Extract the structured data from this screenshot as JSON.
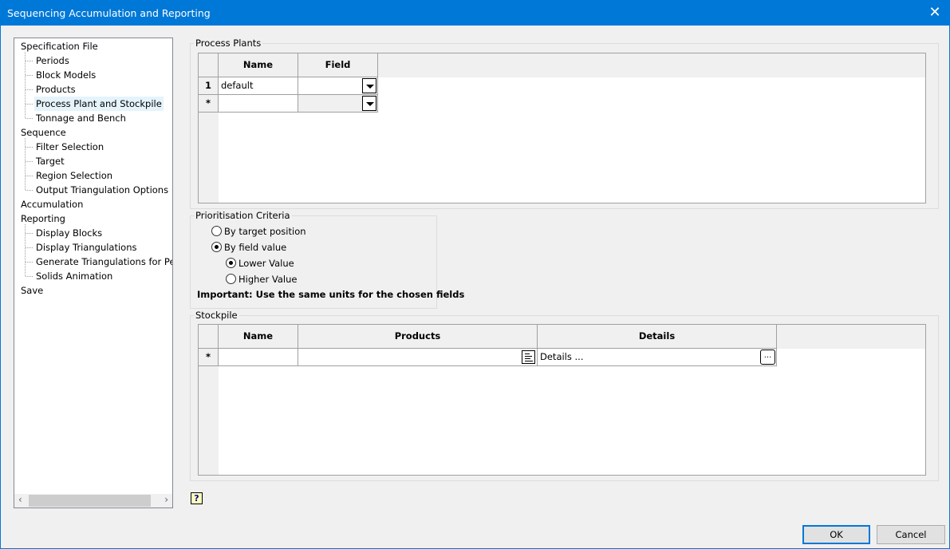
{
  "window": {
    "title": "Sequencing Accumulation and Reporting",
    "close": "✕"
  },
  "tree": {
    "items": [
      {
        "label": "Specification File",
        "level": 0
      },
      {
        "label": "Periods",
        "level": 1
      },
      {
        "label": "Block Models",
        "level": 1
      },
      {
        "label": "Products",
        "level": 1
      },
      {
        "label": "Process Plant and Stockpile",
        "level": 1,
        "selected": true
      },
      {
        "label": "Tonnage and Bench",
        "level": 1
      },
      {
        "label": "Sequence",
        "level": 0
      },
      {
        "label": "Filter Selection",
        "level": 1
      },
      {
        "label": "Target",
        "level": 1
      },
      {
        "label": "Region Selection",
        "level": 1
      },
      {
        "label": "Output Triangulation Options",
        "level": 1
      },
      {
        "label": "Accumulation",
        "level": 0
      },
      {
        "label": "Reporting",
        "level": 0
      },
      {
        "label": "Display Blocks",
        "level": 1
      },
      {
        "label": "Display Triangulations",
        "level": 1
      },
      {
        "label": "Generate Triangulations for Periods",
        "level": 1
      },
      {
        "label": "Solids Animation",
        "level": 1
      },
      {
        "label": "Save",
        "level": 0
      }
    ]
  },
  "process_plants": {
    "title": "Process Plants",
    "headers": [
      "Name",
      "Field"
    ],
    "rows": [
      {
        "num": "1",
        "name": "default",
        "field": ""
      },
      {
        "num": "*",
        "name": "",
        "field": ""
      }
    ]
  },
  "prioritisation": {
    "title": "Prioritisation Criteria",
    "by_target": "By target position",
    "by_field": "By field value",
    "lower": "Lower Value",
    "higher": "Higher Value",
    "note": "Important: Use the same units for the chosen fields",
    "selected": "By field value",
    "sub_selected": "Lower Value"
  },
  "stockpile": {
    "title": "Stockpile",
    "headers": [
      "Name",
      "Products",
      "Details"
    ],
    "rows": [
      {
        "num": "*",
        "name": "",
        "products": "",
        "details": "Details ...",
        "btn": "..."
      }
    ]
  },
  "footer": {
    "help": "?",
    "ok": "OK",
    "cancel": "Cancel"
  }
}
